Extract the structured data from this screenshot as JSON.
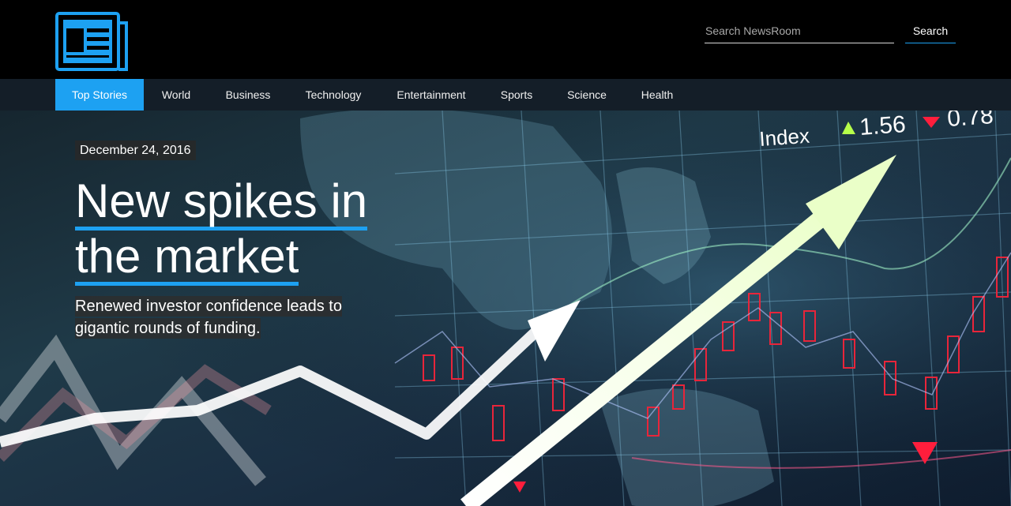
{
  "header": {
    "logo_icon": "newspaper-icon",
    "search_placeholder": "Search NewsRoom",
    "search_button_label": "Search",
    "accent_color": "#1da1f2"
  },
  "nav": {
    "items": [
      {
        "label": "Top Stories",
        "active": true
      },
      {
        "label": "World"
      },
      {
        "label": "Business"
      },
      {
        "label": "Technology"
      },
      {
        "label": "Entertainment"
      },
      {
        "label": "Sports"
      },
      {
        "label": "Science"
      },
      {
        "label": "Health"
      }
    ]
  },
  "hero": {
    "date": "December 24, 2016",
    "headline_line1": "New spikes in",
    "headline_line2": "the market",
    "subheadline": "Renewed investor confidence leads to gigantic rounds of funding.",
    "image_text": {
      "index_label": "Index",
      "index_value": "1.56",
      "index_value2": "0.78"
    }
  }
}
